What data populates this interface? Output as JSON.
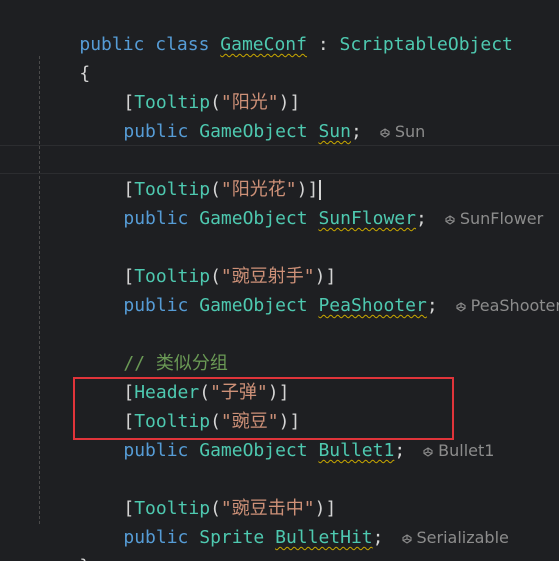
{
  "code": {
    "class_decl": {
      "kw_public": "public",
      "kw_class": "class",
      "name": "GameConf",
      "colon": ":",
      "base": "ScriptableObject"
    },
    "open_brace": "{",
    "close_brace": "}",
    "fields": [
      {
        "tooltip_attr": "Tooltip",
        "tooltip_text": "\"阳光\"",
        "kw": "public",
        "type": "GameObject",
        "name": "Sun",
        "hint": "Sun"
      },
      {
        "tooltip_attr": "Tooltip",
        "tooltip_text": "\"阳光花\"",
        "kw": "public",
        "type": "GameObject",
        "name": "SunFlower",
        "hint": "SunFlower"
      },
      {
        "tooltip_attr": "Tooltip",
        "tooltip_text": "\"豌豆射手\"",
        "kw": "public",
        "type": "GameObject",
        "name": "PeaShooter",
        "hint": "PeaShooter"
      },
      {
        "comment": "// 类似分组",
        "header_attr": "Header",
        "header_text": "\"子弹\"",
        "tooltip_attr": "Tooltip",
        "tooltip_text": "\"豌豆\"",
        "kw": "public",
        "type": "GameObject",
        "name": "Bullet1",
        "hint": "Bullet1"
      },
      {
        "tooltip_attr": "Tooltip",
        "tooltip_text": "\"豌豆击中\"",
        "kw": "public",
        "type": "Sprite",
        "name": "BulletHit",
        "hint": "Serializable"
      }
    ],
    "punct": {
      "open_bracket": "[",
      "close_bracket": "]",
      "open_paren": "(",
      "close_paren": ")",
      "semicolon": ";"
    }
  },
  "icons": {
    "hint_icon": "unity-icon"
  },
  "colors": {
    "background": "#1e1f22",
    "keyword": "#569cd6",
    "type": "#4ec9b0",
    "string": "#ce9178",
    "comment": "#6a9955",
    "highlight_box": "#e0343a"
  }
}
